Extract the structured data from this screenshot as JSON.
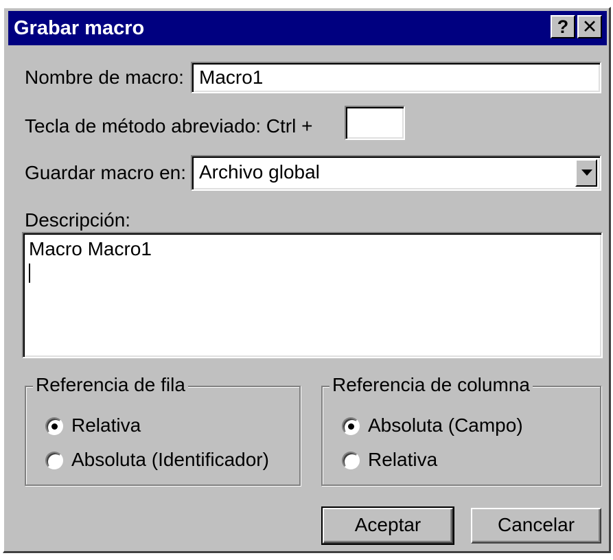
{
  "window": {
    "title": "Grabar macro",
    "help_label": "?",
    "close_label": "✕"
  },
  "form": {
    "macro_name_label": "Nombre de macro:",
    "macro_name_value": "Macro1",
    "shortcut_label": "Tecla de método abreviado:  Ctrl +",
    "shortcut_value": "",
    "save_in_label": "Guardar macro en:",
    "save_in_value": "Archivo global",
    "description_label": "Descripción:",
    "description_value": "Macro Macro1"
  },
  "row_reference": {
    "title": "Referencia de fila",
    "options": [
      {
        "label": "Relativa",
        "selected": true
      },
      {
        "label": "Absoluta (Identificador)",
        "selected": false
      }
    ]
  },
  "column_reference": {
    "title": "Referencia de columna",
    "options": [
      {
        "label": "Absoluta (Campo)",
        "selected": true
      },
      {
        "label": "Relativa",
        "selected": false
      }
    ]
  },
  "buttons": {
    "accept": "Aceptar",
    "cancel": "Cancelar"
  },
  "colors": {
    "titlebar": "#000080",
    "face": "#c0c0c0"
  }
}
